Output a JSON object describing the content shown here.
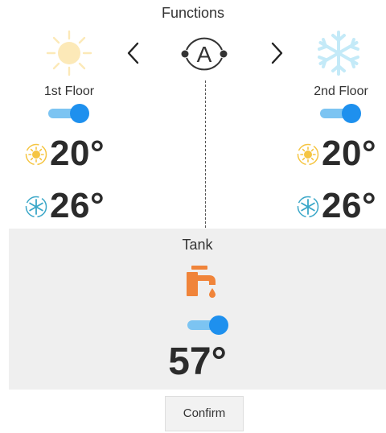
{
  "header": {
    "title": "Functions",
    "mode_icon": "auto-mode-icon",
    "heat_icon": "sun-icon",
    "cool_icon": "snowflake-icon",
    "prev_icon": "chevron-left-icon",
    "next_icon": "chevron-right-icon",
    "mode_letter": "A"
  },
  "floors": [
    {
      "label": "1st Floor",
      "enabled": true,
      "heating_temp": "20°",
      "cooling_temp": "26°"
    },
    {
      "label": "2nd Floor",
      "enabled": true,
      "heating_temp": "20°",
      "cooling_temp": "26°"
    }
  ],
  "tank": {
    "title": "Tank",
    "icon": "faucet-icon",
    "enabled": true,
    "temp": "57°"
  },
  "actions": {
    "confirm_label": "Confirm"
  },
  "colors": {
    "sun": "#fce9b8",
    "sun_small": "#f5c542",
    "snow": "#c4eaf8",
    "snow_small": "#3ba7c8",
    "toggle_track": "#7cc4f2",
    "toggle_knob": "#1e90ee",
    "faucet": "#f0843a",
    "panel": "#efefef"
  }
}
